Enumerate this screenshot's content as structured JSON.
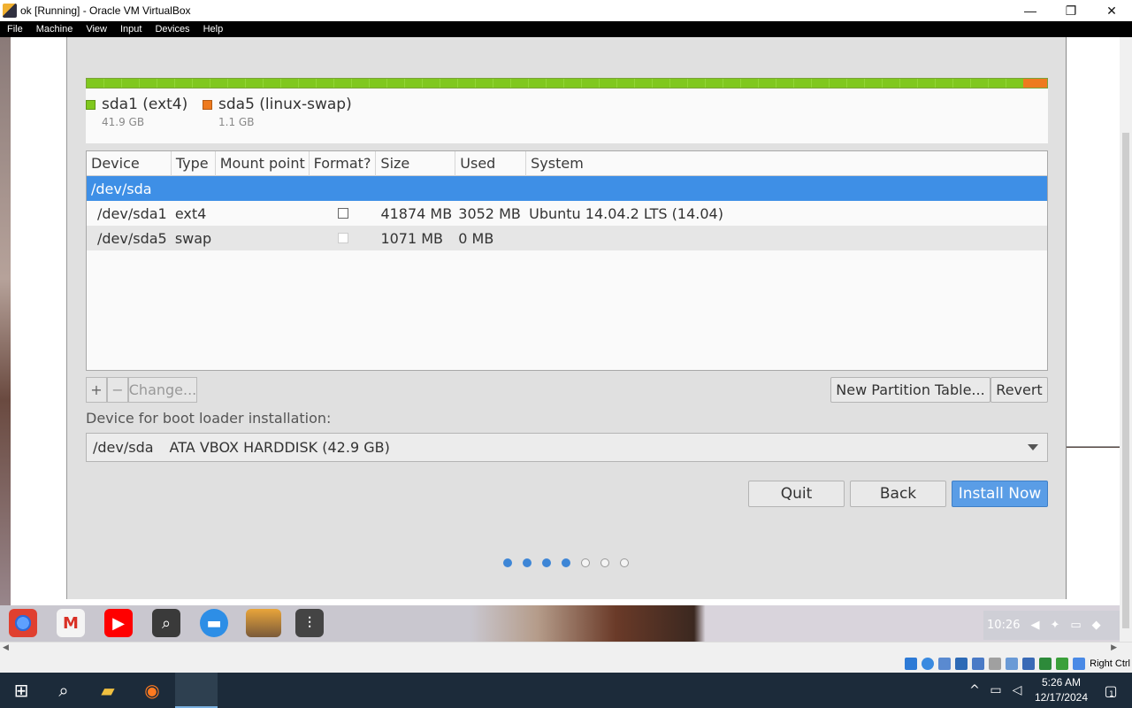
{
  "window": {
    "title": "ok [Running] - Oracle VM VirtualBox",
    "controls": {
      "minimize": "—",
      "maximize": "❐",
      "close": "✕"
    }
  },
  "menu": [
    "File",
    "Machine",
    "View",
    "Input",
    "Devices",
    "Help"
  ],
  "installer": {
    "partitions": [
      {
        "name": "sda1 (ext4)",
        "size": "41.9 GB",
        "color": "#80c81e"
      },
      {
        "name": "sda5 (linux-swap)",
        "size": "1.1 GB",
        "color": "#ee7a1e"
      }
    ],
    "table": {
      "headers": [
        "Device",
        "Type",
        "Mount point",
        "Format?",
        "Size",
        "Used",
        "System"
      ],
      "disk": "/dev/sda",
      "rows": [
        {
          "device": "/dev/sda1",
          "type": "ext4",
          "mount": "",
          "size": "41874 MB",
          "used": "3052 MB",
          "system": "Ubuntu 14.04.2 LTS (14.04)"
        },
        {
          "device": "/dev/sda5",
          "type": "swap",
          "mount": "",
          "size": "1071 MB",
          "used": "0 MB",
          "system": ""
        }
      ]
    },
    "toolbar": {
      "add": "+",
      "remove": "−",
      "change": "Change...",
      "new_table": "New Partition Table...",
      "revert": "Revert"
    },
    "boot_label": "Device for boot loader installation:",
    "boot_device": "/dev/sda",
    "boot_device_desc": "ATA VBOX HARDDISK (42.9 GB)",
    "buttons": {
      "quit": "Quit",
      "back": "Back",
      "install": "Install Now"
    },
    "progress": {
      "current_step": 4,
      "total_steps": 7
    }
  },
  "shelf": {
    "apps": [
      "chrome-icon",
      "gmail-icon",
      "youtube-icon",
      "search-icon",
      "files-icon",
      "virtualbox-icon",
      "settings-icon"
    ],
    "time": "10:26"
  },
  "vbox_status": {
    "host_key": "Right Ctrl"
  },
  "taskbar": {
    "time": "5:26 AM",
    "date": "12/17/2024",
    "notification_count": "1"
  },
  "colors": {
    "accent": "#3e8fe6",
    "ext4": "#80c81e",
    "swap": "#ee7a1e",
    "taskbar": "#1c2b3a"
  }
}
